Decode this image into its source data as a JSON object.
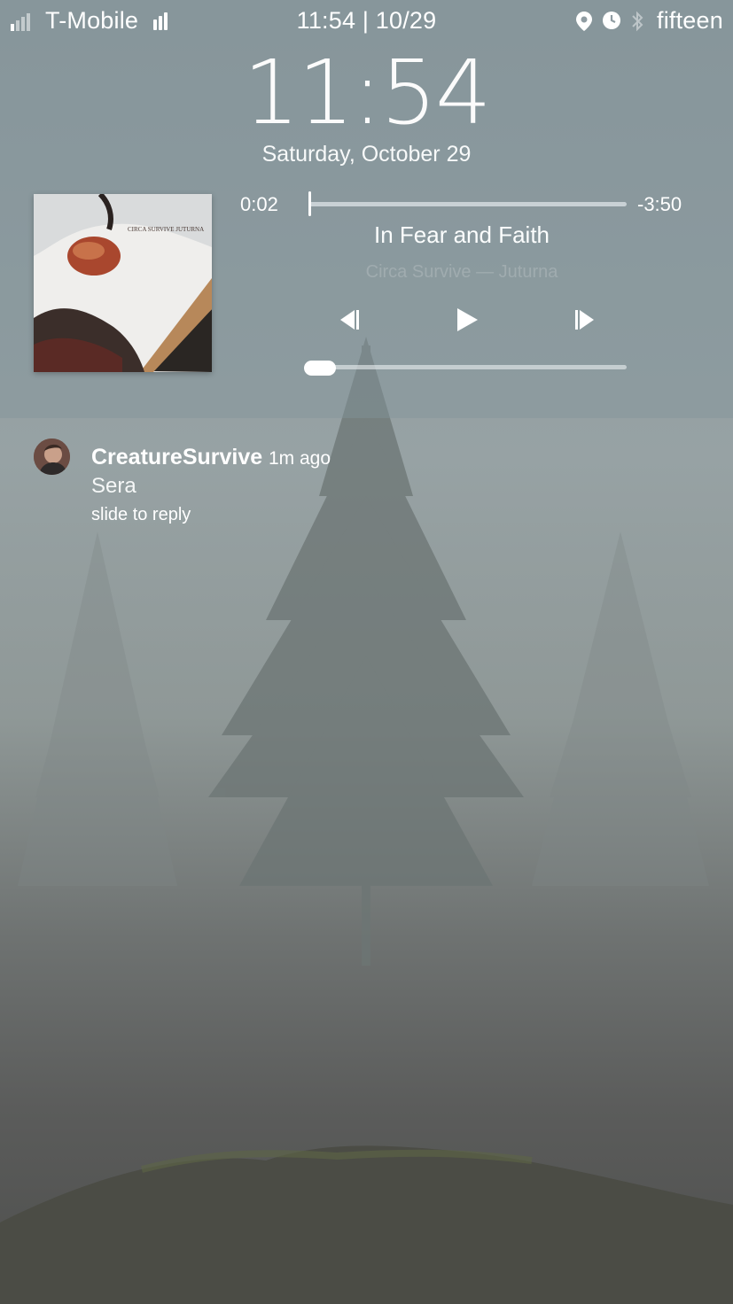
{
  "status_bar": {
    "carrier": "T-Mobile",
    "time_date": "11:54 | 10/29",
    "battery_label": "fifteen",
    "icons": [
      "signal-bars-icon",
      "wifi-bars-icon",
      "location-icon",
      "alarm-icon",
      "bluetooth-icon"
    ]
  },
  "lockscreen": {
    "clock": "11:54",
    "date": "Saturday, October 29"
  },
  "media": {
    "elapsed": "0:02",
    "remaining": "-3:50",
    "progress": 0.01,
    "song": "In Fear and Faith",
    "artist_album": "Circa Survive — Juturna",
    "album_art_text": "CIRCA SURVIVE  JUTURNA",
    "volume": 0.05,
    "controls": [
      "previous-icon",
      "play-icon",
      "next-icon"
    ]
  },
  "notification": {
    "sender": "CreatureSurvive",
    "time_ago": "1m ago",
    "message": "Sera",
    "action": "slide to reply"
  },
  "colors": {
    "panel": "#82949c",
    "text": "#ffffff"
  }
}
